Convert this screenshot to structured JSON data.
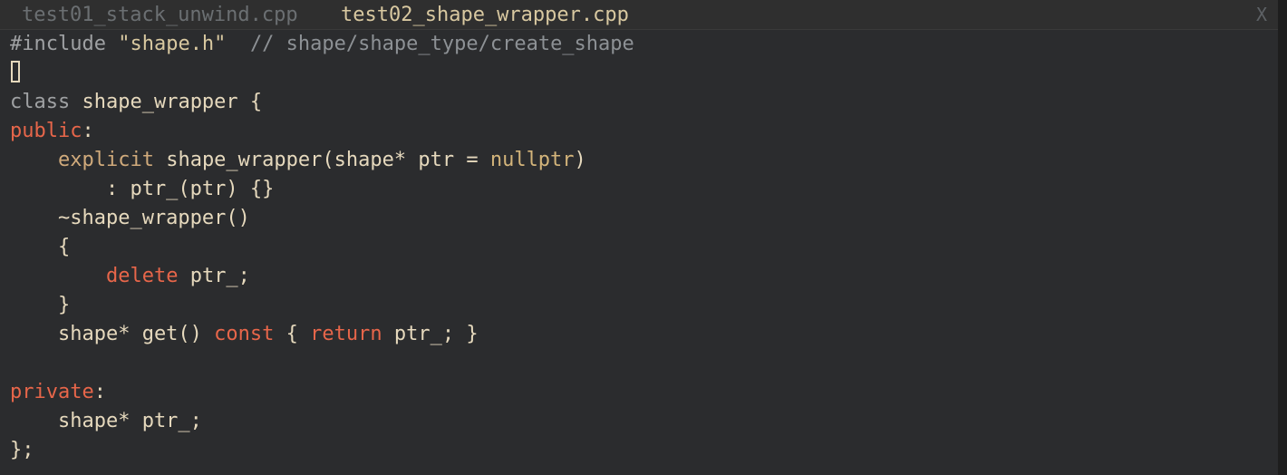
{
  "tabs": [
    {
      "label": "test01_stack_unwind.cpp",
      "active": false
    },
    {
      "label": "test02_shape_wrapper.cpp",
      "active": true
    }
  ],
  "close_label": "X",
  "code": {
    "l1_directive": "#include",
    "l1_string": "\"shape.h\"",
    "l1_comment": "// shape/shape_type/create_shape",
    "l3_class": "class",
    "l3_rest": "shape_wrapper {",
    "l4_access": "public",
    "l4_colon": ":",
    "l5_indent": "    ",
    "l5_explicit": "explicit",
    "l5_rest": "shape_wrapper(shape* ptr = ",
    "l5_nullptr": "nullptr",
    "l5_end": ")",
    "l6": "        : ptr_(ptr) {}",
    "l7": "    ~shape_wrapper()",
    "l8": "    {",
    "l9_indent": "        ",
    "l9_delete": "delete",
    "l9_rest": " ptr_;",
    "l10": "    }",
    "l11_start": "    shape* get() ",
    "l11_const": "const",
    "l11_mid": " { ",
    "l11_return": "return",
    "l11_end": " ptr_; }",
    "l13_access": "private",
    "l13_colon": ":",
    "l14": "    shape* ptr_;",
    "l15": "};"
  },
  "colors": {
    "background": "#2b2c2e",
    "text": "#e6d9bd",
    "keyword": "#d0aa7b",
    "accent_keyword": "#e7664a",
    "comment": "#8d9195"
  }
}
